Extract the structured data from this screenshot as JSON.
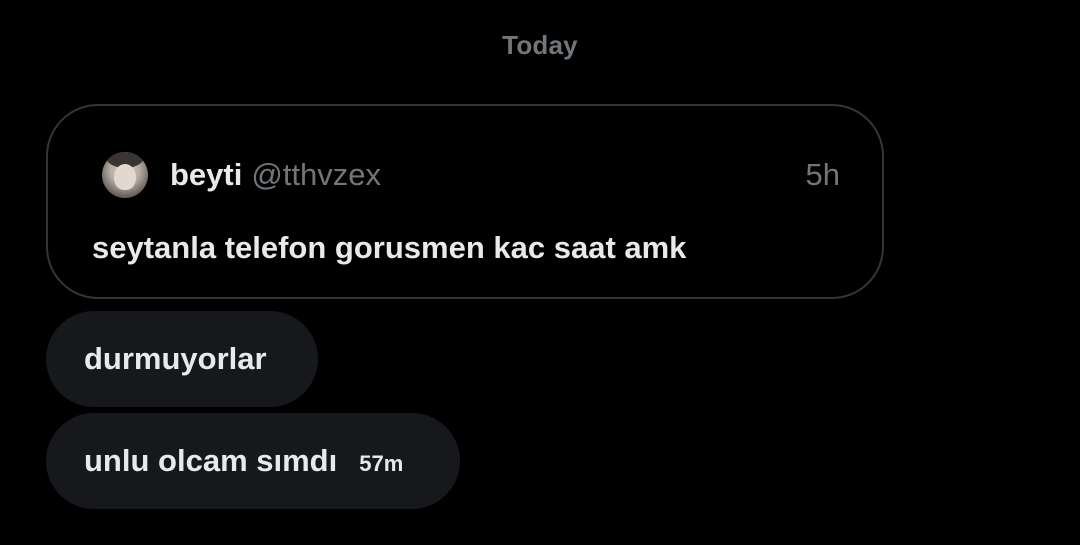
{
  "date_divider": "Today",
  "quoted_post": {
    "author_name": "beyti",
    "author_handle": "@tthvzex",
    "time": "5h",
    "text": "seytanla telefon gorusmen kac saat amk",
    "avatar_icon": "user-avatar"
  },
  "messages": [
    {
      "text": "durmuyorlar",
      "time": ""
    },
    {
      "text": "unlu olcam sımdı",
      "time": "57m"
    }
  ],
  "colors": {
    "background": "#000000",
    "bubble": "#16181c",
    "border": "#333639",
    "primary_text": "#e7e9ea",
    "secondary_text": "#71767b"
  }
}
